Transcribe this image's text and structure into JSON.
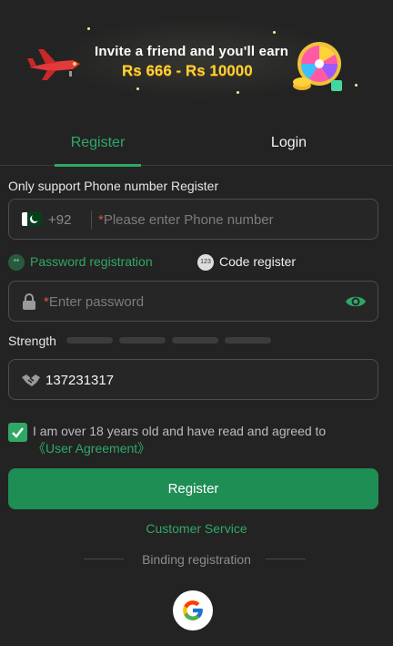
{
  "banner": {
    "line1": "Invite a friend and you'll earn",
    "line2": "Rs 666 - Rs 10000"
  },
  "tabs": [
    {
      "label": "Register",
      "active": true
    },
    {
      "label": "Login",
      "active": false
    }
  ],
  "notice": "Only support Phone number Register",
  "phone": {
    "country_code": "+92",
    "required_mark": "*",
    "placeholder": "Please enter Phone number",
    "flag_icon": "pakistan-flag-icon"
  },
  "modes": {
    "password_label": "Password registration",
    "password_icon_text": "**",
    "code_label": "Code register",
    "code_icon_text": "123"
  },
  "password": {
    "required_mark": "*",
    "placeholder": "Enter password"
  },
  "strength": {
    "label": "Strength",
    "segments": 4,
    "filled": 0
  },
  "invite_code": {
    "value": "137231317",
    "icon": "handshake-icon"
  },
  "agreement": {
    "checked": true,
    "text": "I am over 18 years old and have read and agreed to",
    "link": "《User Agreement》"
  },
  "register_button": "Register",
  "customer_service": "Customer Service",
  "binding_label": "Binding registration",
  "colors": {
    "accent": "#2fa866",
    "button": "#1f8e54",
    "background": "#232323"
  }
}
